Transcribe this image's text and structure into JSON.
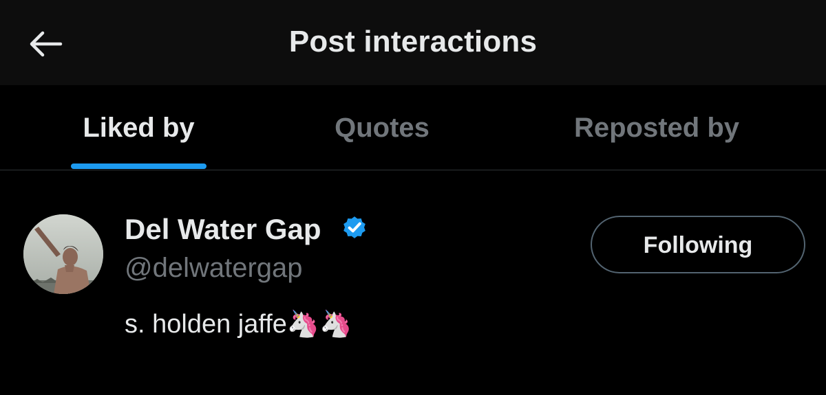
{
  "header": {
    "title": "Post interactions",
    "back_icon": "arrow-left-icon"
  },
  "tabs": [
    {
      "label": "Liked by",
      "active": true
    },
    {
      "label": "Quotes",
      "active": false
    },
    {
      "label": "Reposted by",
      "active": false
    }
  ],
  "users": [
    {
      "display_name": "Del Water Gap",
      "verified": true,
      "handle": "@delwatergap",
      "bio": "s. holden jaffe🦄🦄",
      "follow_label": "Following"
    }
  ],
  "colors": {
    "background": "#000000",
    "header_background": "#0d0d0d",
    "accent": "#1d9bf0",
    "primary_text": "#e7e9ea",
    "secondary_text": "#71767b",
    "divider": "#2f3336"
  }
}
